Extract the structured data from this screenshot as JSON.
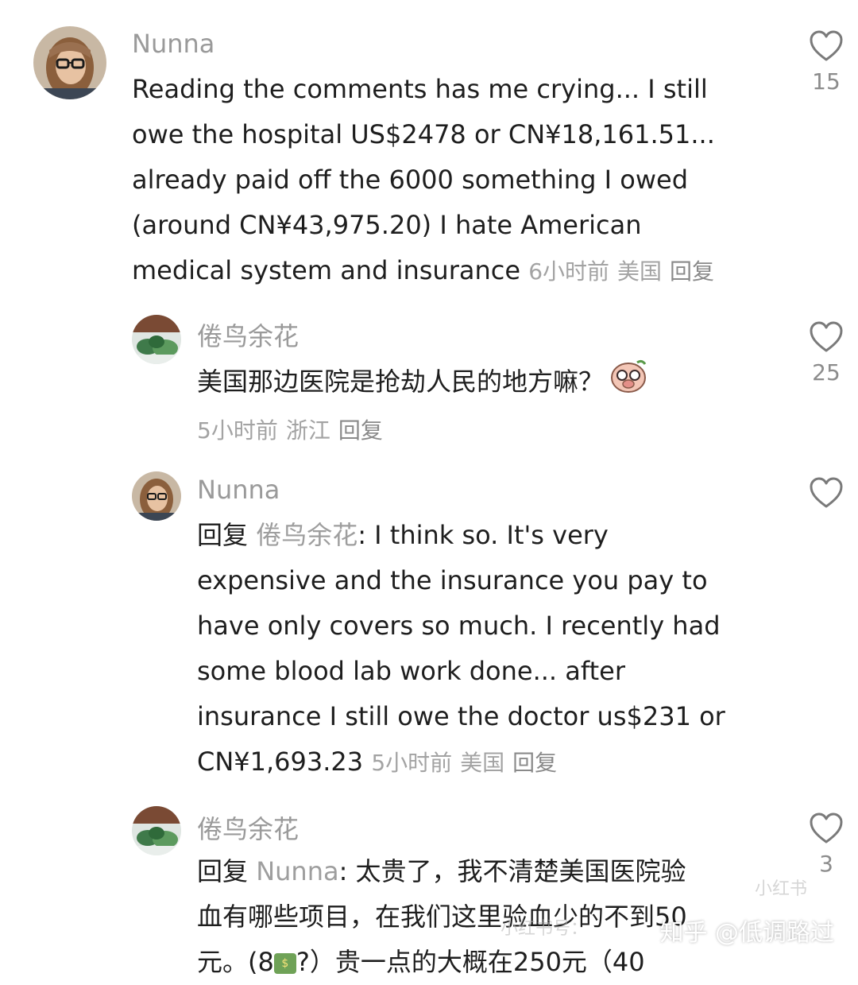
{
  "comments": [
    {
      "username": "Nunna",
      "text": "Reading the comments has me crying... I still owe the hospital US$2478 or CN¥18,161.51... already paid off the 6000 something I owed (around CN¥43,975.20)  I hate American medical system and insurance",
      "time": "6小时前",
      "location": "美国",
      "reply_label": "回复",
      "likes": "15",
      "avatar_icon": "woman-glasses-avatar"
    },
    {
      "username": "倦鸟余花",
      "text": "美国那边医院是抢劫人民的地方嘛？",
      "time": "5小时前",
      "location": "浙江",
      "reply_label": "回复",
      "likes": "25",
      "avatar_icon": "plant-avatar",
      "sticker_icon": "confused-pig-sticker"
    },
    {
      "username": "Nunna",
      "reply_prefix": "回复",
      "reply_target": "倦鸟余花",
      "text": ": I think so. It's very expensive and the insurance you pay to have only covers so much. I recently had some blood lab work done... after insurance I still owe the doctor us$231 or CN¥1,693.23",
      "time": "5小时前",
      "location": "美国",
      "reply_label": "回复",
      "avatar_icon": "woman-glasses-avatar"
    },
    {
      "username": "倦鸟余花",
      "reply_prefix": "回复",
      "reply_target": "Nunna",
      "text_line1": ": 太贵了，我不清楚美国医院验",
      "text_line2": "血有哪些项目，在我们这里验血少的不到50",
      "text_line3a": "元。(8",
      "text_line3b": "?）贵一点的大概在250元（40",
      "likes": "3",
      "avatar_icon": "plant-avatar"
    }
  ],
  "watermark": "知乎 @低调路过",
  "faint_watermark_1": "小红书",
  "faint_watermark_2": "小红书号：",
  "colors": {
    "username": "#9a9a9a",
    "meta": "#a3a3a3",
    "text": "#1e1e1e",
    "heart_stroke": "#7a7a7a"
  }
}
